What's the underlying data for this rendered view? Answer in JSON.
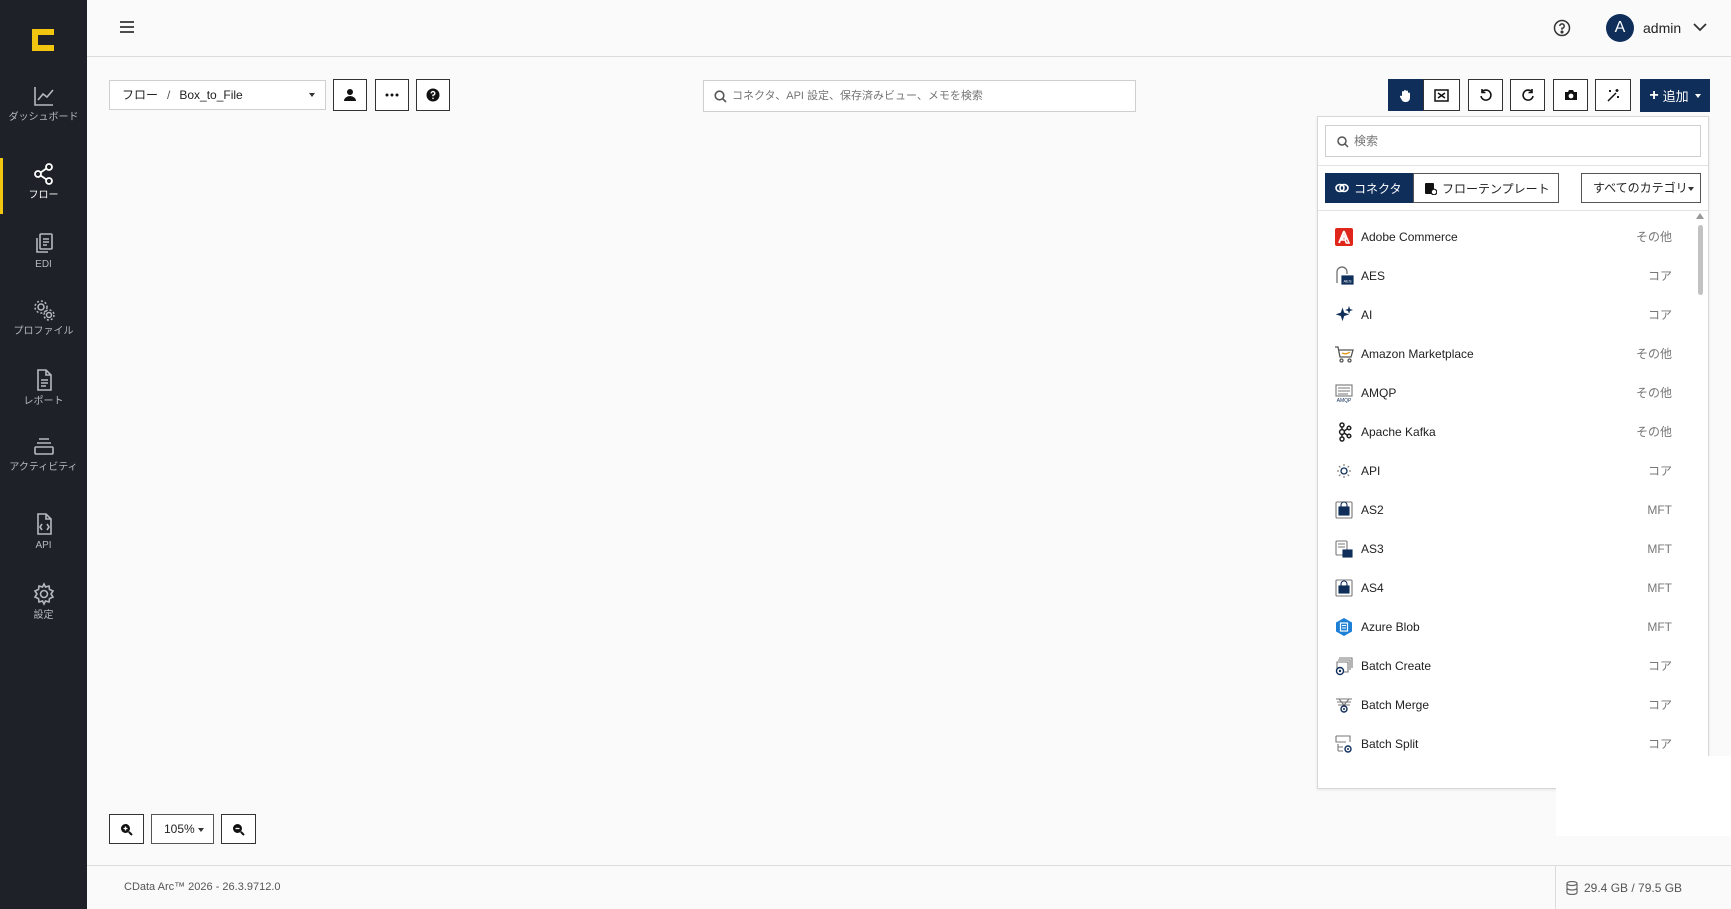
{
  "sidebar": {
    "items": [
      {
        "label": "ダッシュボード",
        "icon": "chart-line-icon"
      },
      {
        "label": "フロー",
        "icon": "share-nodes-icon"
      },
      {
        "label": "EDI",
        "icon": "documents-icon"
      },
      {
        "label": "プロファイル",
        "icon": "gears-icon"
      },
      {
        "label": "レポート",
        "icon": "report-icon"
      },
      {
        "label": "アクティビティ",
        "icon": "layers-icon"
      },
      {
        "label": "API",
        "icon": "api-file-icon"
      },
      {
        "label": "設定",
        "icon": "gear-icon"
      }
    ],
    "active": "フロー"
  },
  "header": {
    "avatar_initial": "A",
    "user_name": "admin"
  },
  "toolbar": {
    "breadcrumb_root": "フロー",
    "breadcrumb_sep": "/",
    "flow_name": "Box_to_File",
    "search_placeholder": "コネクタ、API 設定、保存済みビュー、メモを検索",
    "add_label": "追加"
  },
  "panel": {
    "search_placeholder": "検索",
    "tab_connectors": "コネクタ",
    "tab_templates": "フローテンプレート",
    "category_select": "すべてのカテゴリ",
    "connectors": [
      {
        "name": "Adobe Commerce",
        "category": "その他",
        "icon": "adobe-icon"
      },
      {
        "name": "AES",
        "category": "コア",
        "icon": "aes-lock-icon"
      },
      {
        "name": "AI",
        "category": "コア",
        "icon": "ai-sparkle-icon"
      },
      {
        "name": "Amazon Marketplace",
        "category": "その他",
        "icon": "cart-icon"
      },
      {
        "name": "AMQP",
        "category": "その他",
        "icon": "amqp-icon"
      },
      {
        "name": "Apache Kafka",
        "category": "その他",
        "icon": "kafka-icon"
      },
      {
        "name": "API",
        "category": "コア",
        "icon": "api-gear-icon"
      },
      {
        "name": "AS2",
        "category": "MFT",
        "icon": "as2-icon"
      },
      {
        "name": "AS3",
        "category": "MFT",
        "icon": "as3-icon"
      },
      {
        "name": "AS4",
        "category": "MFT",
        "icon": "as4-icon"
      },
      {
        "name": "Azure Blob",
        "category": "MFT",
        "icon": "azure-blob-icon"
      },
      {
        "name": "Batch Create",
        "category": "コア",
        "icon": "batch-create-icon"
      },
      {
        "name": "Batch Merge",
        "category": "コア",
        "icon": "batch-merge-icon"
      },
      {
        "name": "Batch Split",
        "category": "コア",
        "icon": "batch-split-icon"
      }
    ]
  },
  "zoom": {
    "level": "105%"
  },
  "footer": {
    "version": "CData Arc™ 2026 - 26.3.9712.0",
    "storage": "29.4 GB / 79.5 GB"
  },
  "colors": {
    "sidebar_bg": "#1e2228",
    "accent_yellow": "#f2c511",
    "primary_navy": "#0f2e5a",
    "adobe_red": "#e0251b",
    "azure_blue": "#1d7fd6"
  }
}
